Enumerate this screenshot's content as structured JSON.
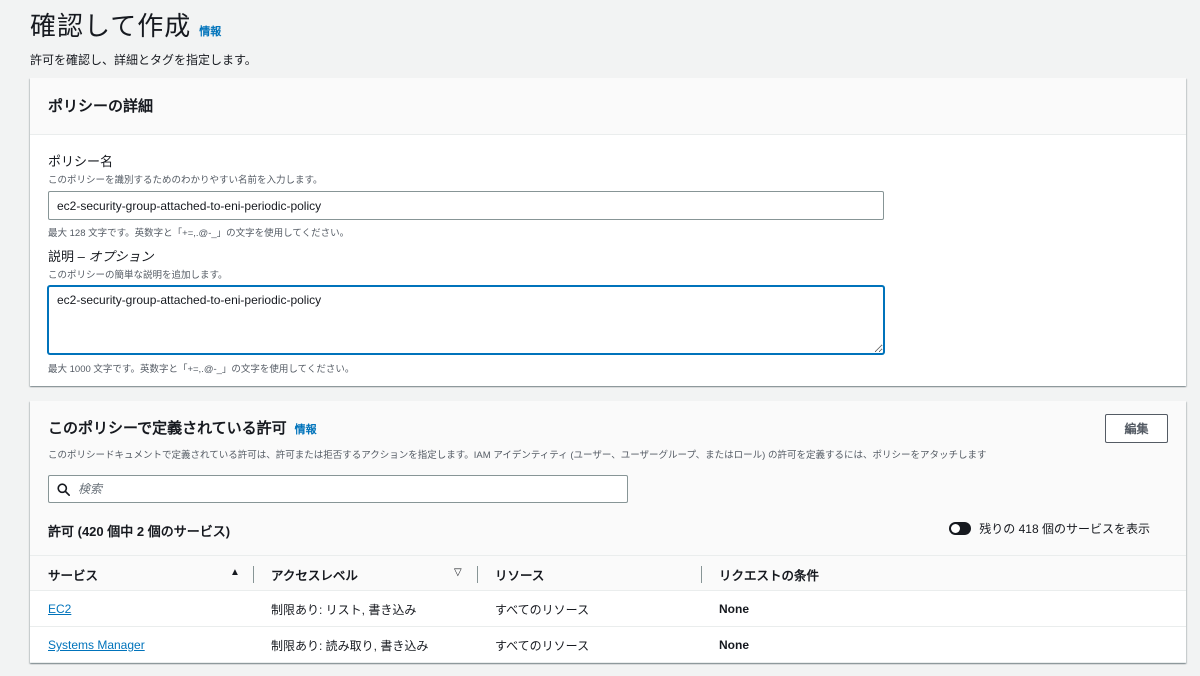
{
  "header": {
    "title": "確認して作成",
    "info": "情報",
    "description": "許可を確認し、詳細とタグを指定します。"
  },
  "policy_details": {
    "title": "ポリシーの詳細",
    "name_label": "ポリシー名",
    "name_hint": "このポリシーを識別するためのわかりやすい名前を入力します。",
    "name_value": "ec2-security-group-attached-to-eni-periodic-policy",
    "name_constraint": "最大 128 文字です。英数字と「+=,.@-_」の文字を使用してください。",
    "desc_label": "説明 – ",
    "desc_label_optional": "オプション",
    "desc_hint": "このポリシーの簡単な説明を追加します。",
    "desc_value": "ec2-security-group-attached-to-eni-periodic-policy",
    "desc_constraint": "最大 1000 文字です。英数字と「+=,.@-_」の文字を使用してください。"
  },
  "permissions": {
    "title": "このポリシーで定義されている許可",
    "info": "情報",
    "description": "このポリシードキュメントで定義されている許可は、許可または拒否するアクションを指定します。IAM アイデンティティ (ユーザー、ユーザーグループ、またはロール) の許可を定義するには、ポリシーをアタッチします",
    "edit_label": "編集",
    "search_placeholder": "検索",
    "count_title": "許可 (420 個中 2 個のサービス)",
    "toggle_label": "残りの 418 個のサービスを表示",
    "columns": [
      "サービス",
      "アクセスレベル",
      "リソース",
      "リクエストの条件"
    ],
    "rows": [
      {
        "service": "EC2",
        "access": "制限あり: リスト, 書き込み",
        "resource": "すべてのリソース",
        "condition": "None"
      },
      {
        "service": "Systems Manager",
        "access": "制限あり: 読み取り, 書き込み",
        "resource": "すべてのリソース",
        "condition": "None"
      }
    ]
  },
  "icons": {
    "search": "search-icon",
    "sort_asc": "caret-up-icon",
    "sort_desc": "caret-down-outline-icon",
    "toggle": "toggle-switch-icon"
  },
  "colors": {
    "link": "#0073bb",
    "background": "#f2f3f3",
    "panel_header": "#fafafa",
    "focus": "#0073bb"
  }
}
